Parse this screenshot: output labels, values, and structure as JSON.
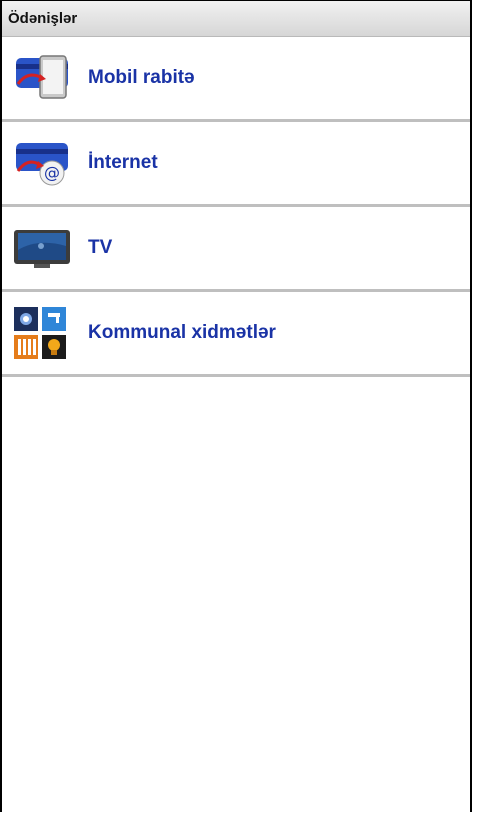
{
  "header": {
    "title": "Ödənişlər"
  },
  "menu": {
    "items": [
      {
        "label": "Mobil rabitə",
        "icon": "mobile-card-icon"
      },
      {
        "label": "İnternet",
        "icon": "internet-card-icon"
      },
      {
        "label": "TV",
        "icon": "tv-icon"
      },
      {
        "label": "Kommunal xidmətlər",
        "icon": "utilities-icon"
      }
    ]
  },
  "colors": {
    "link": "#1a33a6",
    "divider": "#bfbfbf",
    "header_bg": "#e3e3e3"
  }
}
